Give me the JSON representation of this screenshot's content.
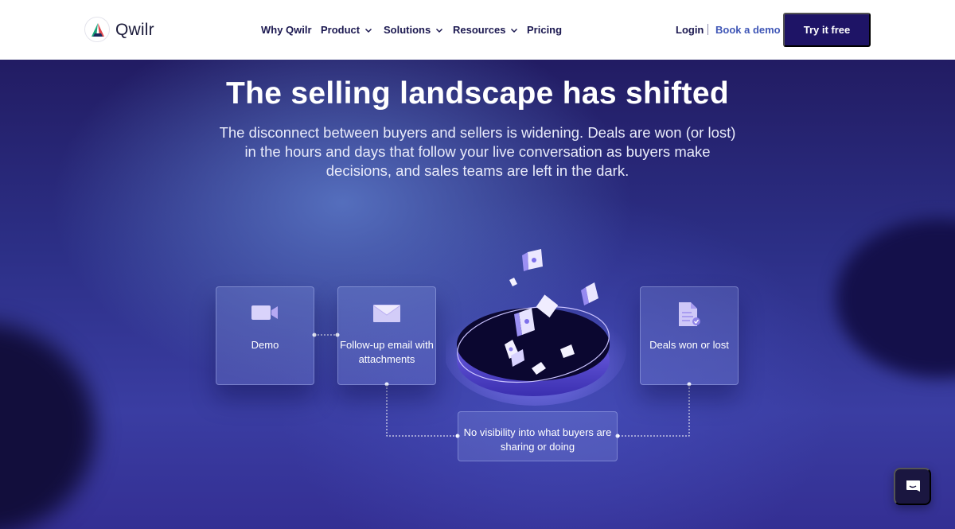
{
  "brand": {
    "name": "Qwilr"
  },
  "nav": {
    "items": [
      {
        "label": "Why Qwilr",
        "has_dropdown": false
      },
      {
        "label": "Product",
        "has_dropdown": true
      },
      {
        "label": "Solutions",
        "has_dropdown": true
      },
      {
        "label": "Resources",
        "has_dropdown": true
      },
      {
        "label": "Pricing",
        "has_dropdown": false
      }
    ],
    "login": "Login",
    "book_demo": "Book a demo",
    "cta": "Try it free"
  },
  "hero": {
    "title": "The selling landscape has shifted",
    "subtitle": "The disconnect between buyers and sellers is widening. Deals are won (or lost) in the hours and days that follow your live conversation as buyers make decisions, and sales teams are left in the dark."
  },
  "flow": {
    "cards": [
      {
        "label": "Demo",
        "icon": "video-camera-icon"
      },
      {
        "label": "Follow-up email with attachments",
        "icon": "envelope-icon"
      },
      {
        "label": "Deals won or lost",
        "icon": "document-icon"
      }
    ],
    "gap_label": "No visibility into what buyers are sharing or doing"
  },
  "colors": {
    "nav_text": "#1b1850",
    "book_demo": "#3f56b6",
    "cta_bg": "#1e1466",
    "hero_dark": "#1d1a5e",
    "card_icon": "#c8c2f5"
  },
  "chat_widget": {
    "icon": "chat-bubble-icon"
  }
}
